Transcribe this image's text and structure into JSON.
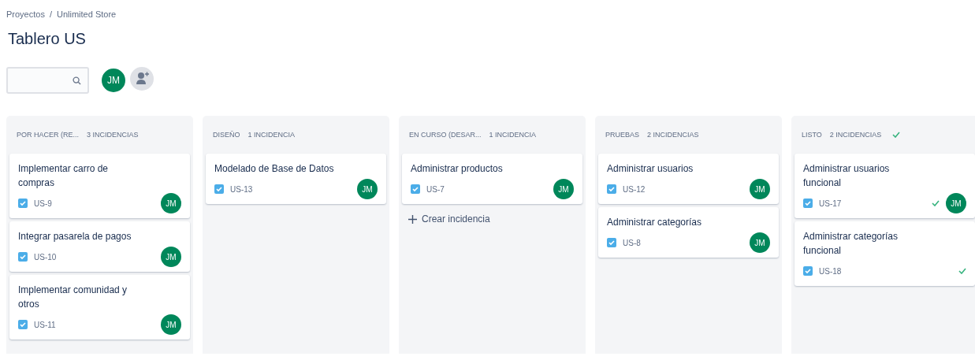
{
  "breadcrumb": [
    {
      "label": "Proyectos",
      "separator": "/"
    },
    {
      "label": "Unlimited Store"
    }
  ],
  "title": "Tablero US",
  "toolbar": {
    "avatars": [
      {
        "initials": "JM"
      }
    ]
  },
  "columns": [
    {
      "title": "POR HACER (RE...",
      "count": "3 INCIDENCIAS",
      "done": false,
      "cards": [
        {
          "title": "Implementar carro de compras",
          "key": "US-9",
          "done": false,
          "assignee": "JM"
        },
        {
          "title": "Integrar pasarela de pagos",
          "key": "US-10",
          "done": false,
          "assignee": "JM"
        },
        {
          "title": "Implementar comunidad y otros",
          "key": "US-11",
          "done": false,
          "assignee": "JM"
        }
      ]
    },
    {
      "title": "DISEÑO",
      "count": "1 INCIDENCIA",
      "done": false,
      "cards": [
        {
          "title": "Modelado de Base de Datos",
          "key": "US-13",
          "done": false,
          "assignee": "JM"
        }
      ]
    },
    {
      "title": "EN CURSO (DESAR...",
      "count": "1 INCIDENCIA",
      "done": false,
      "create": "Crear incidencia",
      "cards": [
        {
          "title": "Administrar productos",
          "key": "US-7",
          "done": false,
          "assignee": "JM"
        }
      ]
    },
    {
      "title": "PRUEBAS",
      "count": "2 INCIDENCIAS",
      "done": false,
      "cards": [
        {
          "title": "Administrar usuarios",
          "key": "US-12",
          "done": false,
          "assignee": "JM"
        },
        {
          "title": "Administrar categorías",
          "key": "US-8",
          "done": false,
          "assignee": "JM"
        }
      ]
    },
    {
      "title": "LISTO",
      "count": "2 INCIDENCIAS",
      "done": true,
      "cards": [
        {
          "title": "Administrar usuarios funcional",
          "key": "US-17",
          "done": true,
          "assignee": "JM"
        },
        {
          "title": "Administrar categorías funcional",
          "key": "US-18",
          "done": true
        }
      ]
    }
  ]
}
